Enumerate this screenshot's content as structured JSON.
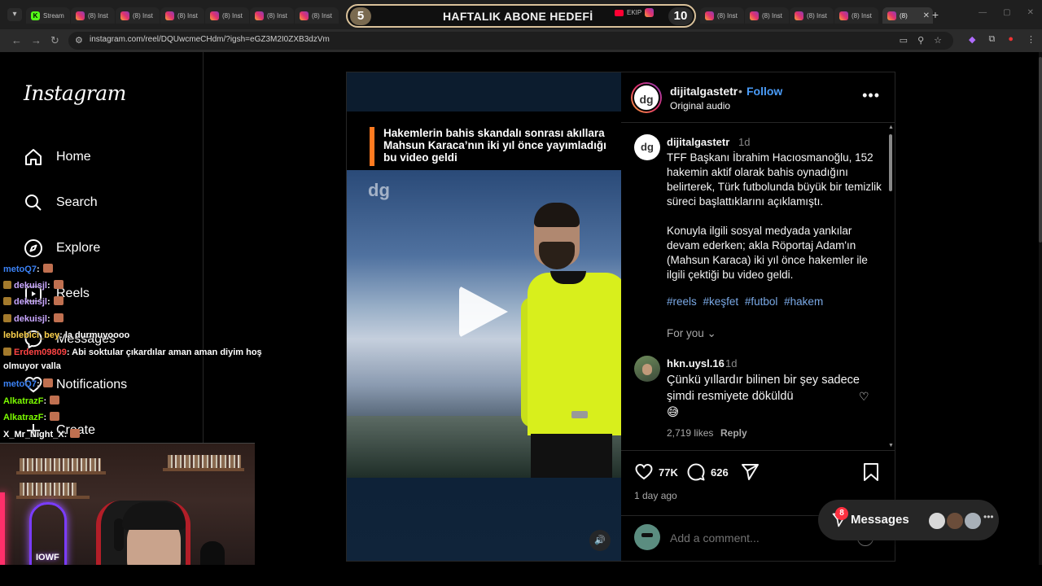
{
  "browser": {
    "tabs_left": [
      {
        "label": "Stream",
        "favicon": "kick-icon"
      },
      {
        "label": "(8) Inst",
        "favicon": "instagram-icon"
      },
      {
        "label": "(8) Inst",
        "favicon": "instagram-icon"
      },
      {
        "label": "(8) Inst",
        "favicon": "instagram-icon"
      },
      {
        "label": "(8) Inst",
        "favicon": "instagram-icon"
      },
      {
        "label": "(8) Inst",
        "favicon": "instagram-icon"
      },
      {
        "label": "(8) Inst",
        "favicon": "instagram-icon"
      }
    ],
    "tab_ekip": "EKIP ",
    "tabs_right": [
      {
        "label": "(8) Inst",
        "favicon": "instagram-icon"
      },
      {
        "label": "(8) Inst",
        "favicon": "instagram-icon"
      },
      {
        "label": "(8) Inst",
        "favicon": "instagram-icon"
      },
      {
        "label": "(8) Inst",
        "favicon": "instagram-icon"
      }
    ],
    "active_tab": {
      "label": "(8)",
      "close": "✕"
    },
    "url": "instagram.com/reel/DQUwcmeCHdm/?igsh=eGZ3M2I0ZXB3dzVm"
  },
  "stream_goal": {
    "left_count": "5",
    "title": "HAFTALIK ABONE HEDEFİ",
    "right_count": "10"
  },
  "sidebar": {
    "logo": "Instagram",
    "items": [
      {
        "label": "Home",
        "icon": "home-icon"
      },
      {
        "label": "Search",
        "icon": "search-icon"
      },
      {
        "label": "Explore",
        "icon": "compass-icon"
      },
      {
        "label": "Reels",
        "icon": "reels-icon"
      },
      {
        "label": "Messages",
        "icon": "messenger-icon"
      },
      {
        "label": "Notifications",
        "icon": "heart-icon"
      },
      {
        "label": "Create",
        "icon": "plus-icon"
      }
    ]
  },
  "video": {
    "caption": "Hakemlerin bahis skandalı sonrası akıllara Mahsun Karaca’nın iki yıl önce yayımladığı bu video geldi",
    "watermark": "dg",
    "accent": "#ff7a20"
  },
  "post": {
    "username": "dijitalgastetr",
    "separator": "•",
    "follow_label": "Follow",
    "audio": "Original audio",
    "more": "•••",
    "caption_user": "dijitalgastetr",
    "caption_time": "1d",
    "caption": "TFF Başkanı İbrahim Hacıosmanoğlu, 152 hakemin aktif olarak bahis oynadığını belirterek, Türk futbolunda büyük bir temizlik süreci başlattıklarını açıklamıştı.\n\nKonuyla ilgili sosyal medyada yankılar devam ederken; akla Röportaj Adam'ın (Mahsun Karaca) iki yıl önce hakemler ile ilgili çektiği bu video geldi.",
    "hashtags": [
      "#reels",
      "#keşfet",
      "#futbol",
      "#hakem"
    ],
    "for_you": "For you",
    "comment": {
      "user": "hkn.uysl.16",
      "time": "1d",
      "text": "Çünkü yıllardır bilinen bir şey sadece şimdi resmiyete döküldü\n😅",
      "likes": "2,719 likes",
      "reply": "Reply"
    },
    "like_count": "77K",
    "comment_count": "626",
    "date": "1 day ago",
    "add_comment_placeholder": "Add a comment..."
  },
  "messages_pill": {
    "label": "Messages",
    "badge": "8"
  },
  "chat": [
    {
      "user": "metoQ7",
      "color": "#3b82f6",
      "text": ":"
    },
    {
      "user": "dekuisjl",
      "color": "#c9a7ff",
      "text": ":"
    },
    {
      "user": "dekuisjl",
      "color": "#c9a7ff",
      "text": ":"
    },
    {
      "user": "dekuisjl",
      "color": "#c9a7ff",
      "text": ":"
    },
    {
      "user": "leblebici_bey",
      "color": "#ffd34d",
      "text": ": la durmuyoooo"
    },
    {
      "user": "Erdem09809",
      "color": "#ff4444",
      "text": ": Abi soktular çıkardılar aman aman diyim hoş"
    },
    {
      "user": "",
      "color": "#ffffff",
      "text": "olmuyor valla"
    },
    {
      "user": "metoQ7",
      "color": "#3b82f6",
      "text": ":"
    },
    {
      "user": "AlkatrazF",
      "color": "#7cfc00",
      "text": ":"
    },
    {
      "user": "AlkatrazF",
      "color": "#7cfc00",
      "text": ":"
    },
    {
      "user": "X_Mr_Night_X",
      "color": "#ffffff",
      "text": ":"
    }
  ],
  "webcam": {
    "neon_label": "IOWF"
  }
}
